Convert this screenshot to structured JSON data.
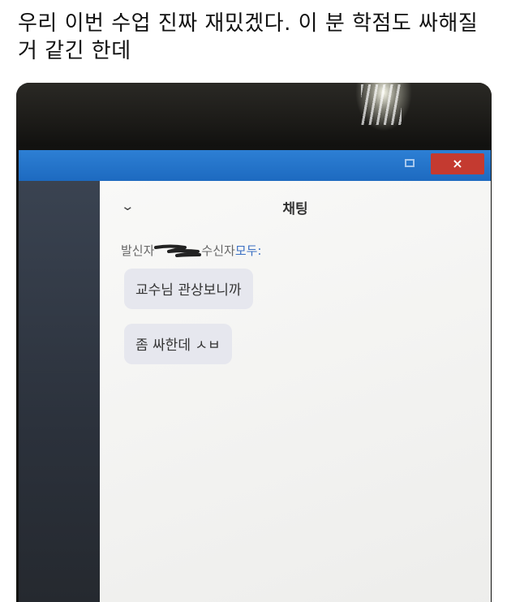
{
  "post": {
    "text": "우리 이번 수업 진짜 재밌겠다. 이 분 학점도 싸해질거 같긴 한데"
  },
  "window": {
    "close_label": "×"
  },
  "chat": {
    "title": "채팅",
    "sender_label": "발신자",
    "receiver_label": "수신자",
    "receiver_value": "모두:",
    "messages": [
      {
        "text": "교수님 관상보니까"
      },
      {
        "text": "좀 싸한데 ㅅㅂ"
      }
    ]
  },
  "colors": {
    "titlebar": "#1d6ac0",
    "close_button": "#c43a30",
    "recipient_link": "#3b6fc2",
    "bubble": "#e6e7ee"
  }
}
